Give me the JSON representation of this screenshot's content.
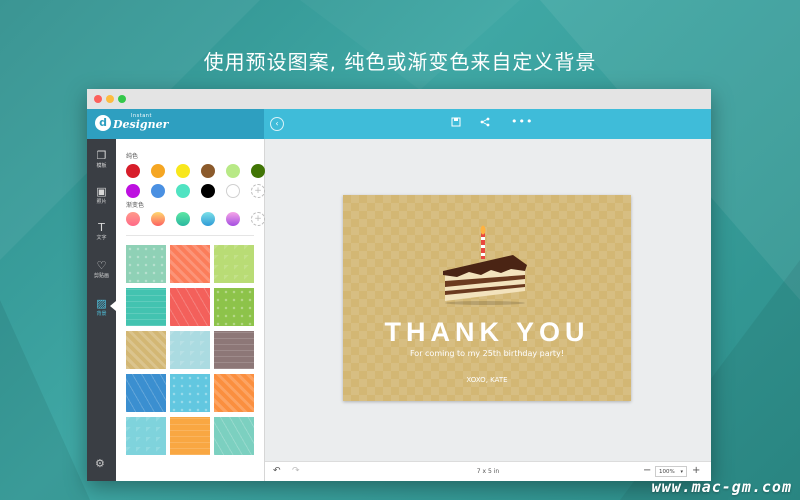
{
  "headline": "使用预设图案, 纯色或渐变色来自定义背景",
  "app": {
    "logo_letter": "d",
    "logo_brand": "Designer",
    "logo_small": "Instant"
  },
  "rail": {
    "items": [
      {
        "label": "模板",
        "icon": "template-icon"
      },
      {
        "label": "照片",
        "icon": "photo-icon"
      },
      {
        "label": "文字",
        "icon": "text-icon"
      },
      {
        "label": "剪贴画",
        "icon": "heart-icon"
      },
      {
        "label": "背景",
        "icon": "background-icon",
        "active": true
      }
    ]
  },
  "panel": {
    "solid_label": "纯色",
    "gradient_label": "渐变色",
    "solid_colors": [
      "#d71d2a",
      "#f5a623",
      "#f8e71c",
      "#8b5a2b",
      "#b8e986",
      "#417505",
      "#bd10e0",
      "#4a90e2",
      "#50e3c2",
      "#000000",
      "#ffffff"
    ],
    "gradients": [
      [
        "#ff9a8b",
        "#ff6a88"
      ],
      [
        "#ffd86f",
        "#fc6262"
      ],
      [
        "#5ee7a4",
        "#2ab7a0"
      ],
      [
        "#7ce0e8",
        "#2f9bd6"
      ],
      [
        "#f6a5e8",
        "#a44ee0"
      ]
    ],
    "patterns": [
      "#8fd1b6",
      "#fb7d5a",
      "#b9dc75",
      "#43c3b0",
      "#f3605b",
      "#8dc34a",
      "#d3b774",
      "#abdbe1",
      "#8d7777",
      "#3b8fd0",
      "#62c7e0",
      "#fb8f3f",
      "#7fd3dc",
      "#f9a742",
      "#7cd0c0"
    ]
  },
  "card": {
    "title": "THANK YOU",
    "subtitle": "For coming to my 25th birthday party!",
    "signature": "XOXO, KATE"
  },
  "bottombar": {
    "size": "7 x 5 in",
    "zoom": "100%",
    "minus": "−",
    "plus": "+"
  },
  "watermark": "www.mac-gm.com"
}
